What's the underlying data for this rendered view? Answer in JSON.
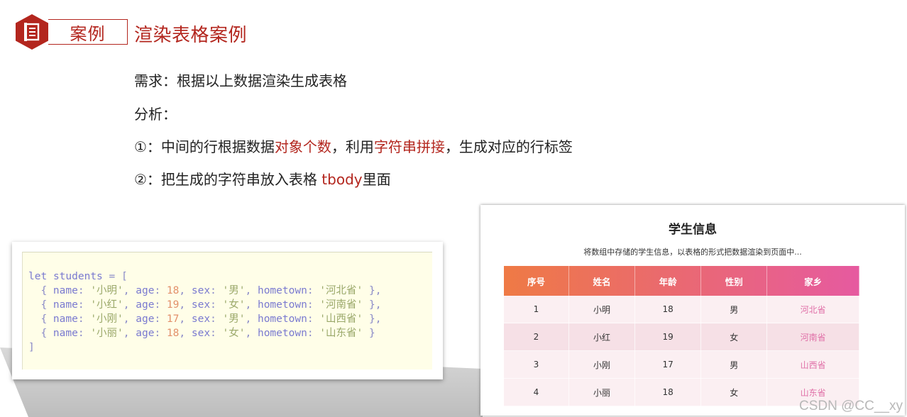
{
  "header": {
    "badge_label": "案例",
    "title": "渲染表格案例"
  },
  "requirements": {
    "line1": "需求：根据以上数据渲染生成表格",
    "line2": "分析：",
    "line3_a": "①：中间的行根据数据",
    "line3_b": "对象个数",
    "line3_c": "，利用",
    "line3_d": "字符串拼接",
    "line3_e": "，生成对应的行标签",
    "line4_a": "②：把生成的字符串放入表格 ",
    "line4_b": "tbody",
    "line4_c": "里面"
  },
  "code": {
    "decl_kw": "let",
    "decl_name": "students",
    "decl_open": " = [",
    "close": "]",
    "rows": [
      {
        "name": "'小明'",
        "age": "18",
        "sex": "'男'",
        "hometown": "'河北省'",
        "tail": " },"
      },
      {
        "name": "'小红'",
        "age": "19",
        "sex": "'女'",
        "hometown": "'河南省'",
        "tail": " },"
      },
      {
        "name": "'小刚'",
        "age": "17",
        "sex": "'男'",
        "hometown": "'山西省'",
        "tail": " },"
      },
      {
        "name": "'小丽'",
        "age": "18",
        "sex": "'女'",
        "hometown": "'山东省'",
        "tail": " }"
      }
    ]
  },
  "table": {
    "title": "学生信息",
    "subtitle": "将数组中存储的学生信息，以表格的形式把数据渲染到页面中...",
    "headers": [
      "序号",
      "姓名",
      "年龄",
      "性别",
      "家乡"
    ],
    "rows": [
      [
        "1",
        "小明",
        "18",
        "男",
        "河北省"
      ],
      [
        "2",
        "小红",
        "19",
        "女",
        "河南省"
      ],
      [
        "3",
        "小刚",
        "17",
        "男",
        "山西省"
      ],
      [
        "4",
        "小丽",
        "18",
        "女",
        "山东省"
      ]
    ]
  },
  "watermark": "CSDN @CC__xy",
  "colors": {
    "accent_red": "#b3261e",
    "header_gradient_start": "#ef7a45",
    "header_gradient_end": "#e65aa0",
    "hometown_pink": "#e06fa7"
  }
}
